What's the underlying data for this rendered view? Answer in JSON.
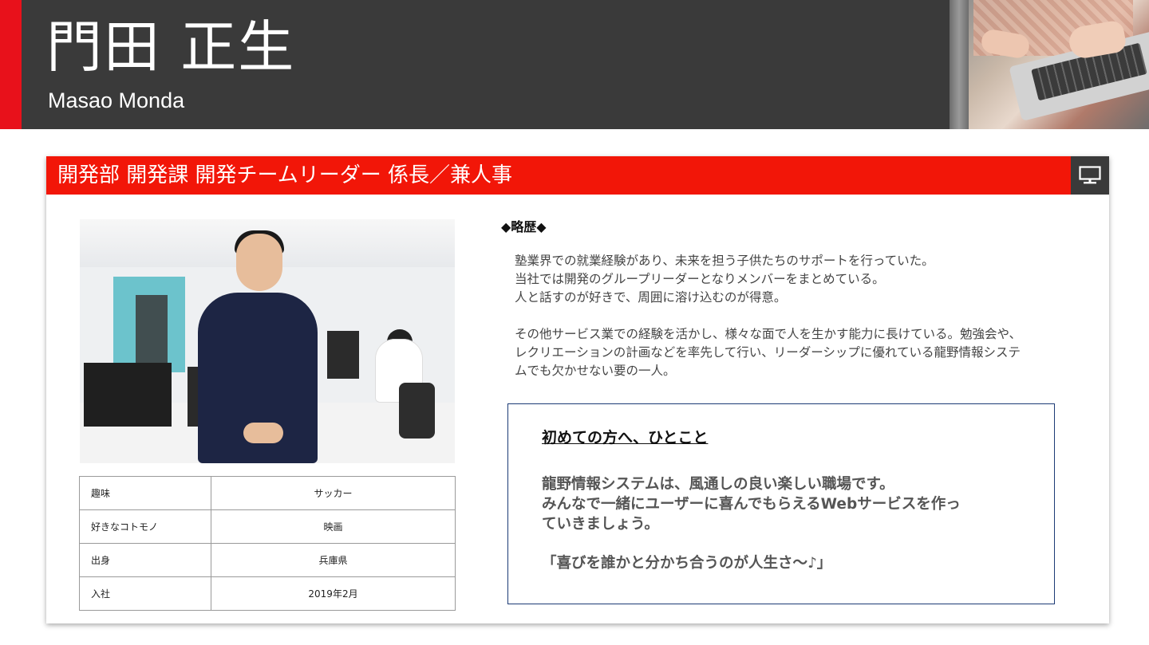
{
  "header": {
    "name_ja": "門田 正生",
    "name_en": "Masao Monda"
  },
  "card": {
    "title": "開発部 開発課 開発チームリーダー 係長／兼人事",
    "icon": "monitor-icon"
  },
  "profile_table": [
    {
      "key": "趣味",
      "value": "サッカー"
    },
    {
      "key": "好きなコトモノ",
      "value": "映画"
    },
    {
      "key": "出身",
      "value": "兵庫県"
    },
    {
      "key": "入社",
      "value": "2019年2月"
    }
  ],
  "career": {
    "heading": "◆略歴◆",
    "lines1": [
      "塾業界での就業経験があり、未来を担う子供たちのサポートを行っていた。",
      "当社では開発のグループリーダーとなりメンバーをまとめている。",
      "人と話すのが好きで、周囲に溶け込むのが得意。"
    ],
    "lines2": [
      "その他サービス業での経験を活かし、様々な面で人を生かす能力に長けている。勉強会や、",
      "レクリエーションの計画などを率先して行い、リーダーシップに優れている龍野情報システ",
      "ムでも欠かせない要の一人。"
    ]
  },
  "message": {
    "title": "初めての方へ、ひとこと",
    "lines": [
      "龍野情報システムは、風通しの良い楽しい職場です。",
      "みんなで一緒にユーザーに喜んでもらえるWebサービスを作っ",
      "ていきましょう。"
    ],
    "quote": "「喜びを誰かと分かち合うのが人生さ〜♪」"
  },
  "colors": {
    "header_bg": "#3a3a3a",
    "accent_red": "#e8111b",
    "card_bar_red": "#f21608",
    "message_border": "#1c3a75"
  }
}
